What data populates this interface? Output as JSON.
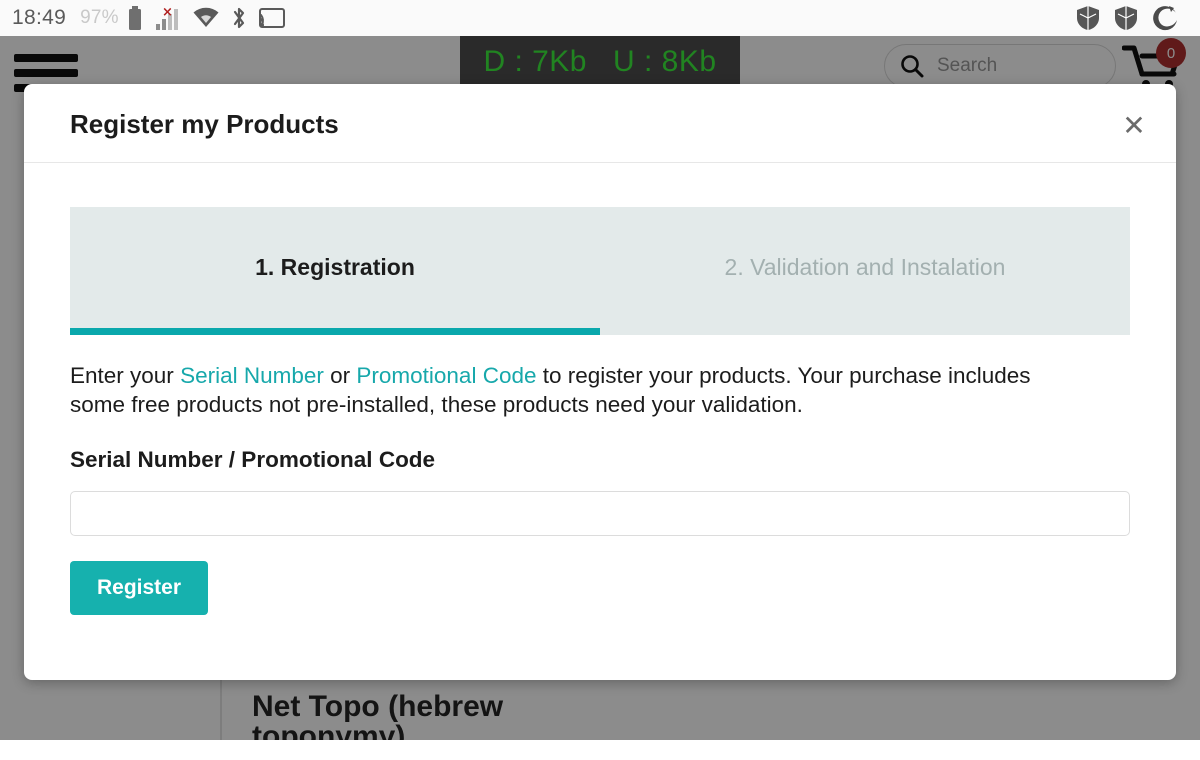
{
  "statusbar": {
    "clock": "18:49",
    "battery_percent": "97%",
    "icons_left": [
      "battery-icon",
      "signal-bars-error-icon",
      "wifi-icon",
      "bluetooth-icon",
      "cast-icon"
    ],
    "icons_right": [
      "shield-icon",
      "shield-icon",
      "firefox-icon"
    ]
  },
  "page": {
    "menu_icon": "hamburger-menu-icon",
    "search": {
      "placeholder": "Search",
      "value": "",
      "icon": "search-icon"
    },
    "cart": {
      "icon": "shopping-cart-icon",
      "badge_count": "0"
    },
    "netspeed": {
      "download": "D : 7Kb",
      "upload": "U : 8Kb",
      "color": "#3cf03c",
      "background": "#4d4d4d"
    },
    "background_title": "Net Topo (hebrew toponymy)"
  },
  "modal": {
    "title": "Register my Products",
    "close_icon": "✕",
    "tabs": [
      {
        "label": "1. Registration",
        "active": true
      },
      {
        "label": "2. Validation and Instalation",
        "active": false
      }
    ],
    "intro": {
      "part1": "Enter your ",
      "link1": "Serial Number",
      "part2": " or ",
      "link2": "Promotional Code",
      "part3": " to register your products. Your purchase includes some free products not pre-installed, these products need your validation."
    },
    "form": {
      "label": "Serial Number / Promotional Code",
      "input_value": "",
      "input_placeholder": "",
      "submit_label": "Register"
    }
  },
  "colors": {
    "accent_teal": "#16b1ae",
    "tab_underline": "#0aa8ac",
    "link_teal": "#17a8ab",
    "tab_panel_bg": "#e3eaea",
    "badge_red": "#b03030"
  }
}
